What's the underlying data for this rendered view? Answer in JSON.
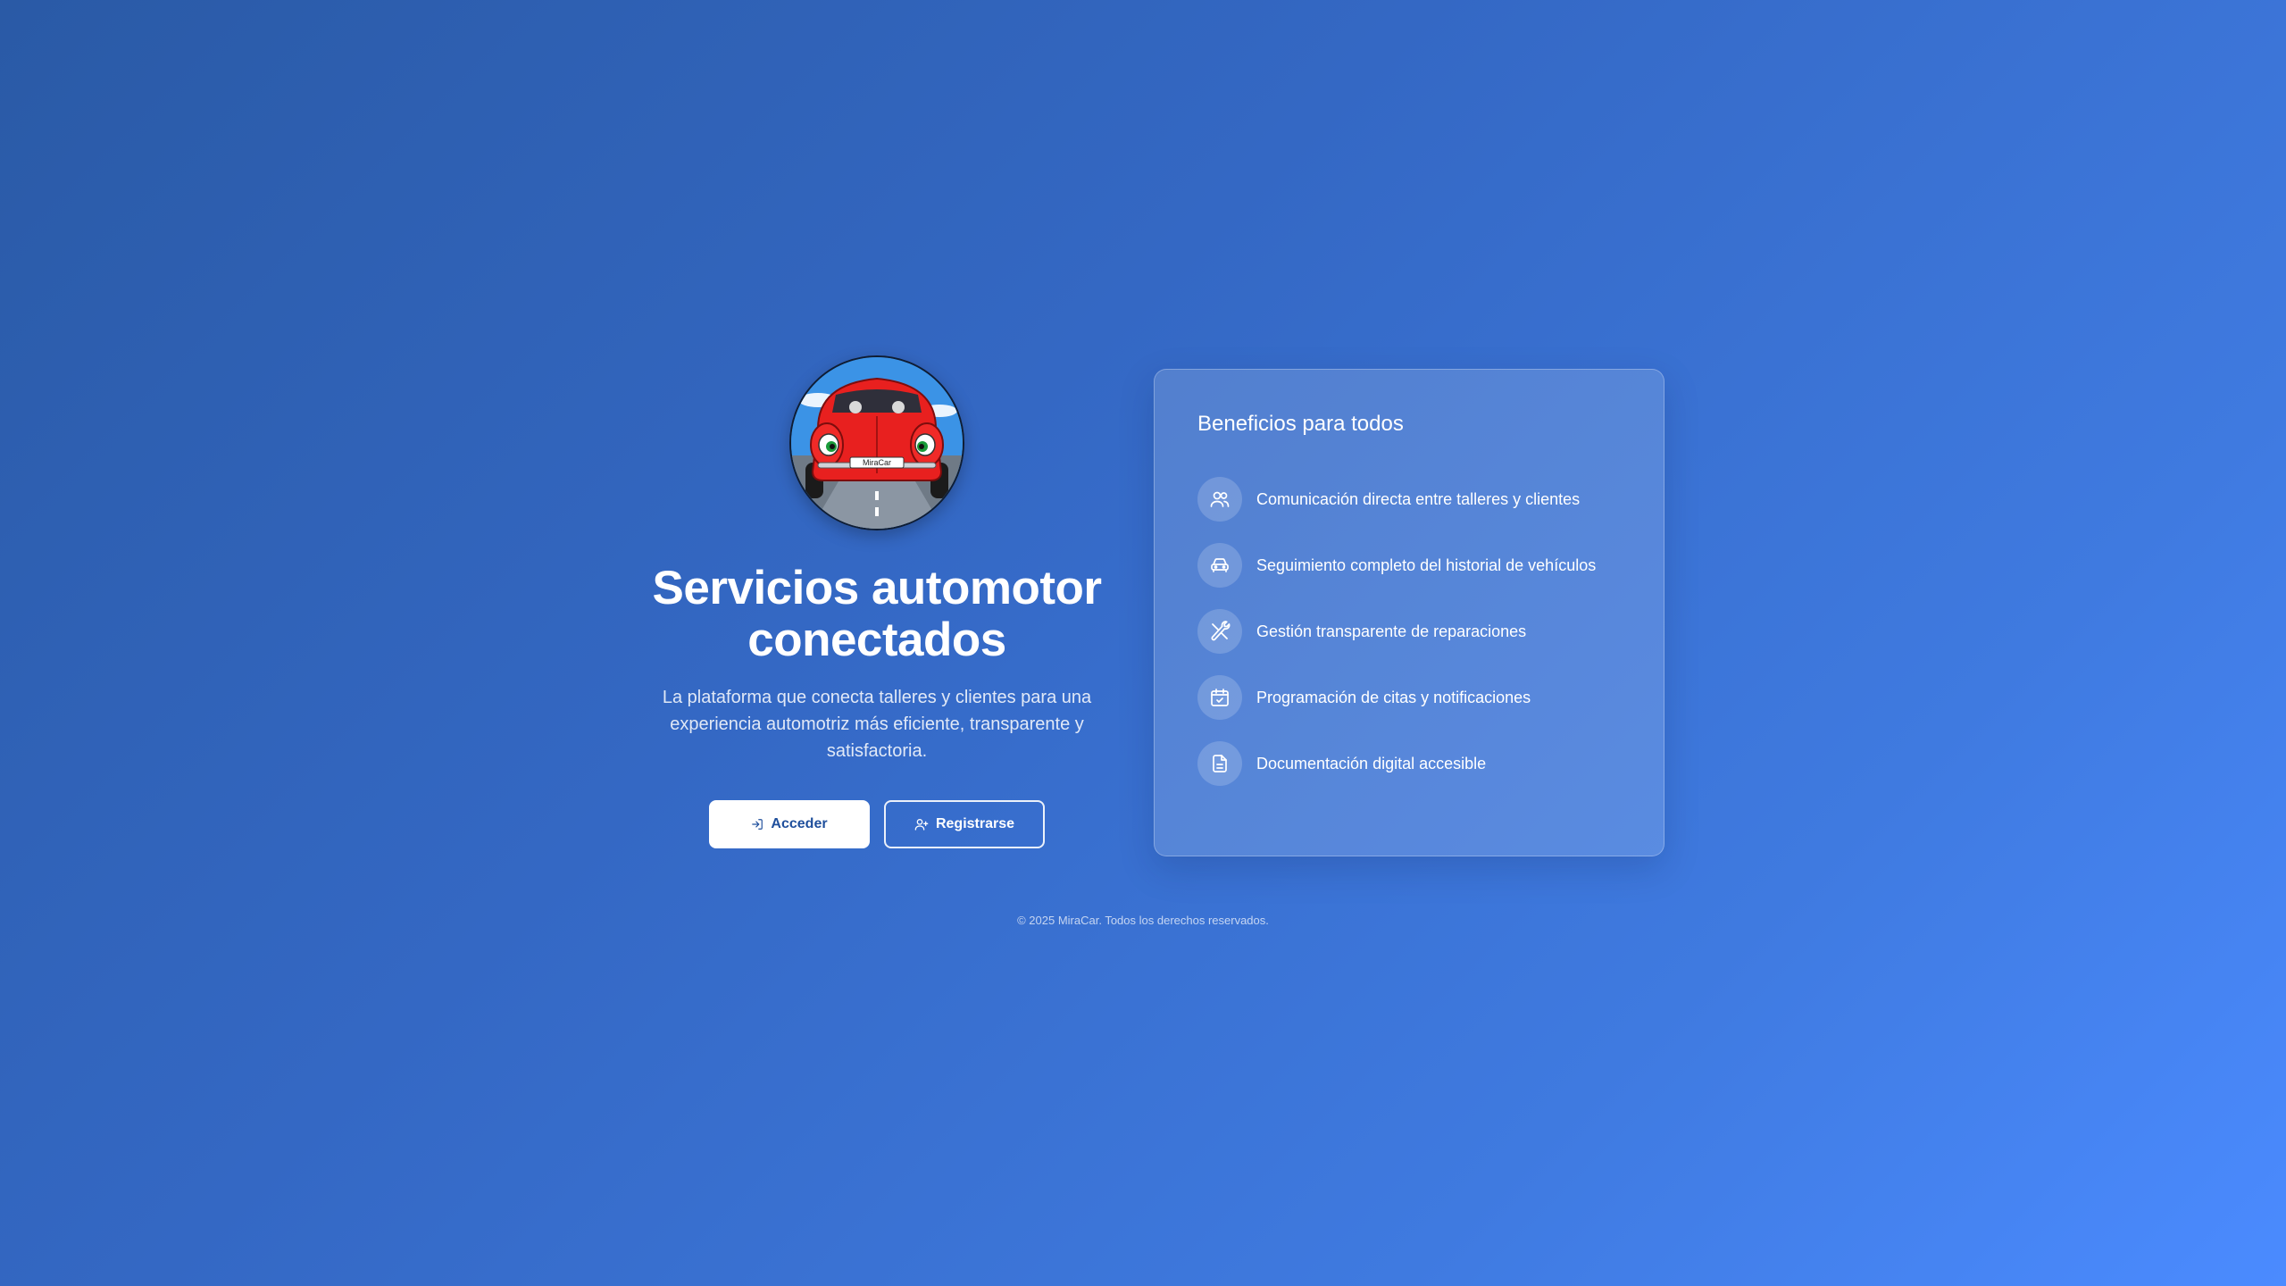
{
  "hero": {
    "logo_plate_text": "MiraCar",
    "title_line1": "Servicios automotor",
    "title_line2": "conectados",
    "subtitle": "La plataforma que conecta talleres y clientes para una experiencia automotriz más eficiente, transparente y satisfactoria.",
    "login_label": "Acceder",
    "register_label": "Registrarse"
  },
  "benefits": {
    "title": "Beneficios para todos",
    "items": [
      {
        "icon": "users-icon",
        "label": "Comunicación directa entre talleres y clientes"
      },
      {
        "icon": "car-icon",
        "label": "Seguimiento completo del historial de vehículos"
      },
      {
        "icon": "wrench-icon",
        "label": "Gestión transparente de reparaciones"
      },
      {
        "icon": "calendar-check-icon",
        "label": "Programación de citas y notificaciones"
      },
      {
        "icon": "document-icon",
        "label": "Documentación digital accesible"
      }
    ]
  },
  "footer": {
    "text": "© 2025 MiraCar. Todos los derechos reservados."
  },
  "colors": {
    "gradient_start": "#2a5aa6",
    "gradient_end": "#4b8bff",
    "button_text": "#1f4f9c",
    "car_red": "#e8201f"
  }
}
